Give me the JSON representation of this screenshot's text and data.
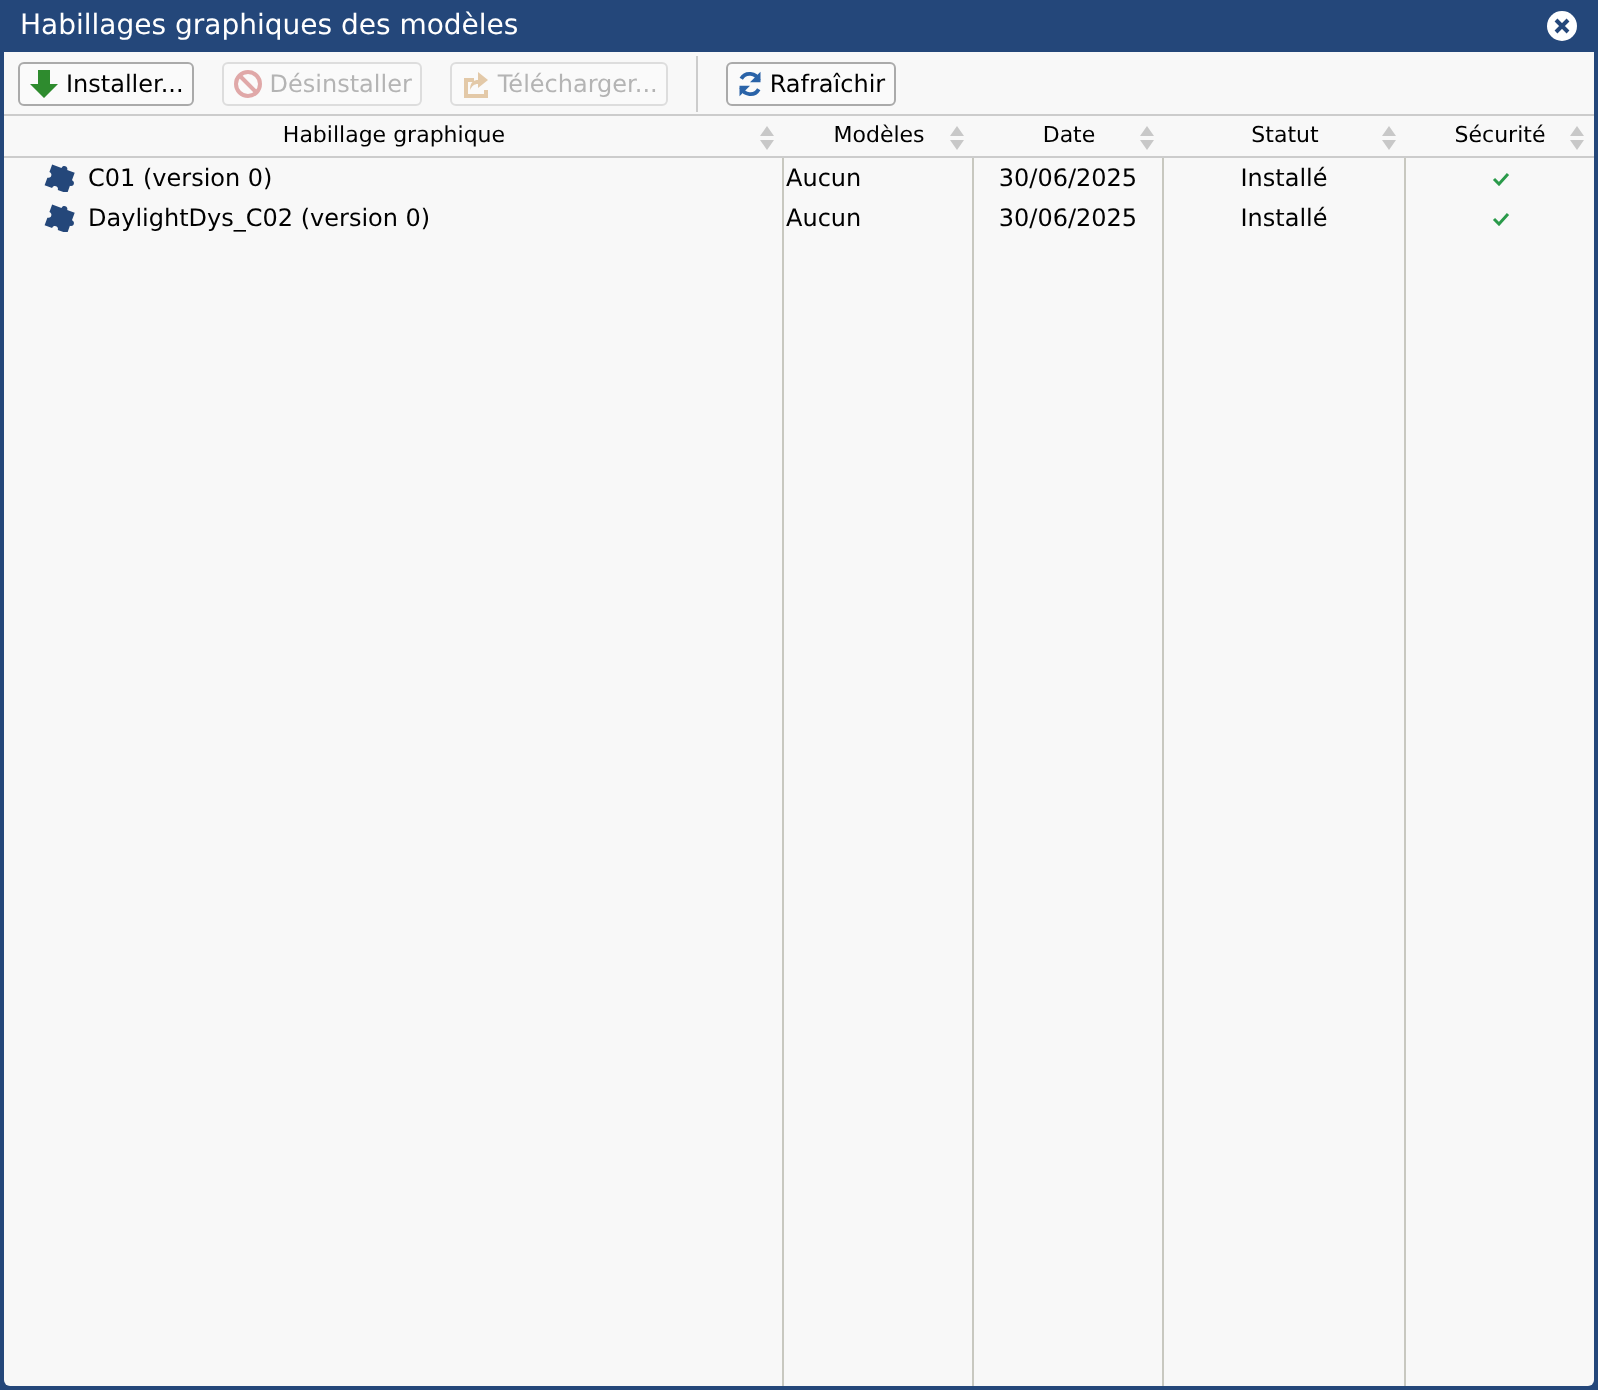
{
  "window": {
    "title": "Habillages graphiques des modèles"
  },
  "toolbar": [
    {
      "kind": "install",
      "label": "Installer...",
      "disabled": false
    },
    {
      "kind": "uninstall",
      "label": "Désinstaller",
      "disabled": true
    },
    {
      "kind": "download",
      "label": "Télécharger...",
      "disabled": true
    },
    {
      "kind": "refresh",
      "label": "Rafraîchir",
      "disabled": false
    }
  ],
  "table": {
    "columns": [
      "Habillage graphique",
      "Modèles",
      "Date",
      "Statut",
      "Sécurité"
    ],
    "rows": [
      {
        "name": "C01 (version 0)",
        "models": "Aucun",
        "date": "30/06/2025",
        "status": "Installé",
        "secure": true
      },
      {
        "name": "DaylightDys_C02 (version 0)",
        "models": "Aucun",
        "date": "30/06/2025",
        "status": "Installé",
        "secure": true
      }
    ]
  }
}
